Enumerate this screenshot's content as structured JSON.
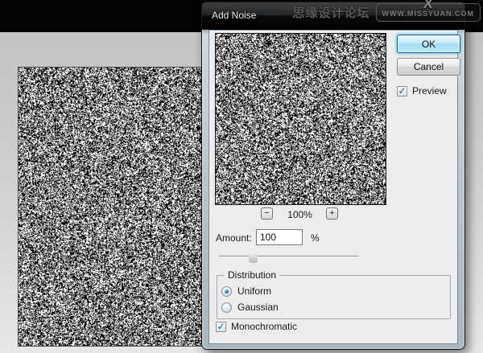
{
  "watermark": {
    "site_name": "思缘设计论坛",
    "site_url": "WWW.MISSYUAN.COM",
    "logo_glyph": "X"
  },
  "dialog": {
    "title": "Add Noise",
    "ok_label": "OK",
    "cancel_label": "Cancel",
    "preview_checkbox": {
      "label": "Preview",
      "checked": true
    },
    "preview_zoom": {
      "zoom_out": "−",
      "level": "100%",
      "zoom_in": "+"
    },
    "amount": {
      "label": "Amount:",
      "value": "100",
      "unit": "%"
    },
    "distribution": {
      "legend": "Distribution",
      "options": [
        {
          "label": "Uniform",
          "selected": true
        },
        {
          "label": "Gaussian",
          "selected": false
        }
      ]
    },
    "monochromatic": {
      "label": "Monochromatic",
      "checked": true
    }
  },
  "icons": {
    "check": "✓"
  },
  "colors": {
    "ok_glow": "#46c3f0",
    "dialog_body": "#ececec",
    "titlebar_text": "#e4e4e4",
    "top_strip": "#040404"
  }
}
